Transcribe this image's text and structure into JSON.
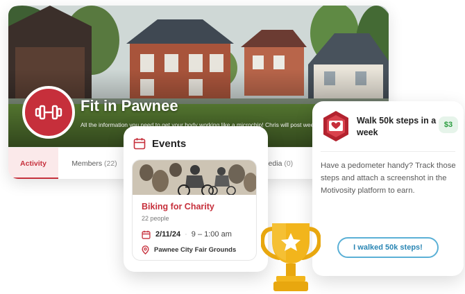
{
  "group": {
    "title": "Fit in Pawnee",
    "description": "All the information you need to get your body working like a microchip! Chris will post weekly from Dr...",
    "logo_icon": "dumbbell-icon",
    "tabs": [
      {
        "label": "Activity",
        "count": ""
      },
      {
        "label": "Members",
        "count": "(22)"
      },
      {
        "label": "Media",
        "count": "(0)"
      }
    ]
  },
  "events": {
    "icon": "calendar-icon",
    "title": "Events",
    "items": [
      {
        "name": "Biking for Charity",
        "people": "22 people",
        "date": "2/11/24",
        "separator": "·",
        "time": "9 – 1:00 am",
        "location": "Pawnee City Fair Grounds"
      }
    ]
  },
  "challenge": {
    "badge_icon": "heart-hexagon-badge-icon",
    "title": "Walk 50k steps in a week",
    "reward": "$3",
    "description": "Have a pedometer handy? Track those steps and attach a screenshot in the Motivosity platform to earn.",
    "cta_label": "I walked 50k steps!"
  },
  "decor": {
    "trophy_icon": "trophy-icon"
  },
  "colors": {
    "brand_red": "#c62f3b",
    "reward_green": "#2a9d3f",
    "cta_blue": "#2a86b4",
    "trophy_gold": "#f2b51c"
  }
}
